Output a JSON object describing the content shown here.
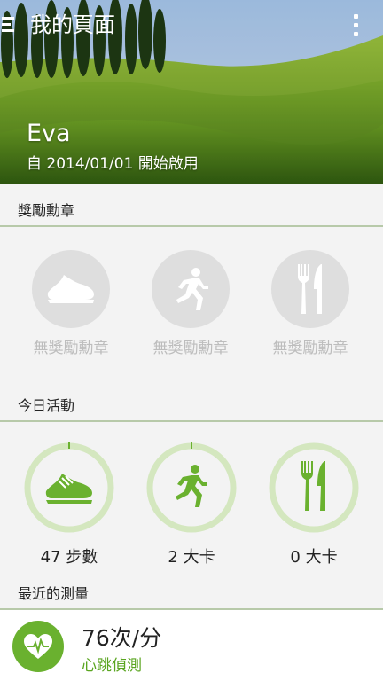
{
  "header": {
    "title": "我的頁面",
    "user_name": "Eva",
    "since_text": "自 2014/01/01 開始啟用",
    "menu_icon": "hamburger-menu-icon",
    "more_icon": "more-vertical-icon"
  },
  "awards": {
    "section_title": "獎勵勳章",
    "items": [
      {
        "icon": "running-shoe-icon",
        "label": "無獎勵勳章"
      },
      {
        "icon": "runner-icon",
        "label": "無獎勵勳章"
      },
      {
        "icon": "fork-knife-icon",
        "label": "無獎勵勳章"
      }
    ]
  },
  "today": {
    "section_title": "今日活動",
    "items": [
      {
        "icon": "running-shoe-icon",
        "label": "47 步數"
      },
      {
        "icon": "runner-icon",
        "label": "2 大卡"
      },
      {
        "icon": "fork-knife-icon",
        "label": "0 大卡"
      }
    ]
  },
  "recent": {
    "section_title": "最近的測量",
    "value": "76次/分",
    "name": "心跳偵測",
    "icon": "heart-rate-icon"
  },
  "colors": {
    "accent_green": "#6ab12f",
    "ring_light": "#d4e7bf",
    "divider": "#b7c9a9",
    "award_gray": "#dedede"
  }
}
